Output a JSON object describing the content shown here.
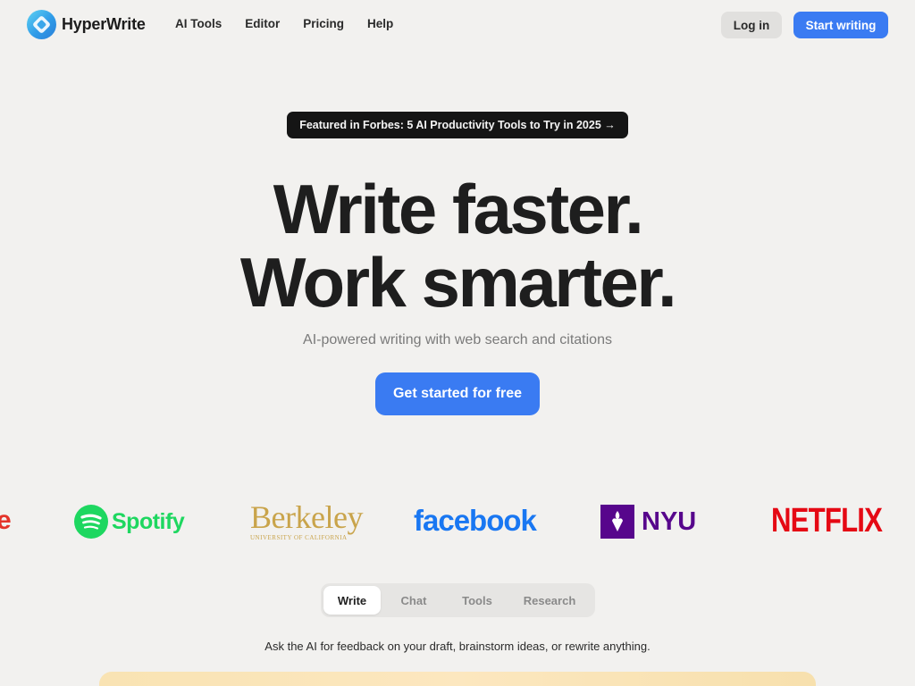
{
  "brand": {
    "name": "HyperWrite"
  },
  "nav": {
    "links": [
      "AI Tools",
      "Editor",
      "Pricing",
      "Help"
    ],
    "login_label": "Log in",
    "start_label": "Start writing"
  },
  "hero": {
    "badge": "Featured in Forbes: 5 AI Productivity Tools to Try in 2025 →",
    "headline_line1": "Write faster.",
    "headline_line2": "Work smarter.",
    "subheadline": "AI-powered writing with web search and citations",
    "cta_label": "Get started for free"
  },
  "logos": {
    "partial": "e",
    "spotify": "Spotify",
    "berkeley": "Berkeley",
    "berkeley_sub": "UNIVERSITY OF CALIFORNIA",
    "facebook": "facebook",
    "nyu": "NYU",
    "netflix": "NETFLIX"
  },
  "tabs": {
    "items": [
      "Write",
      "Chat",
      "Tools",
      "Research"
    ],
    "active": "Write",
    "description": "Ask the AI for feedback on your draft, brainstorm ideas, or rewrite anything."
  },
  "colors": {
    "accent": "#3a7bf2",
    "background": "#f2f1ef",
    "badge_bg": "#151515",
    "preview_gradient": "#fce7bf"
  }
}
